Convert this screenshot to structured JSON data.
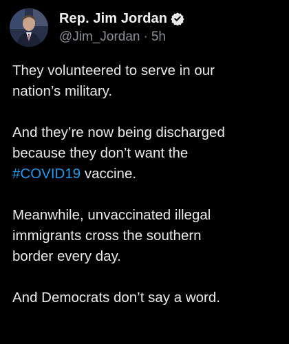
{
  "author": {
    "display_name": "Rep. Jim Jordan",
    "handle": "@Jim_Jordan",
    "separator": "·",
    "timestamp": "5h",
    "verified_icon": "verified-badge-icon",
    "avatar_icon": "profile-avatar"
  },
  "tweet": {
    "p1": {
      "l1": "They volunteered to serve in our",
      "l2": "nation’s military."
    },
    "p2": {
      "l1": "And they’re now being discharged",
      "l2": "because they don’t want the",
      "hashtag": "#COVID19",
      "l3_rest": " vaccine."
    },
    "p3": {
      "l1": "Meanwhile, unvaccinated illegal",
      "l2": "immigrants cross the southern",
      "l3": "border every day."
    },
    "p4": {
      "l1": "And Democrats don’t say a word."
    }
  },
  "colors": {
    "background": "#000000",
    "text": "#e7e9ea",
    "muted": "#8b9096",
    "link": "#1d9bf0"
  }
}
